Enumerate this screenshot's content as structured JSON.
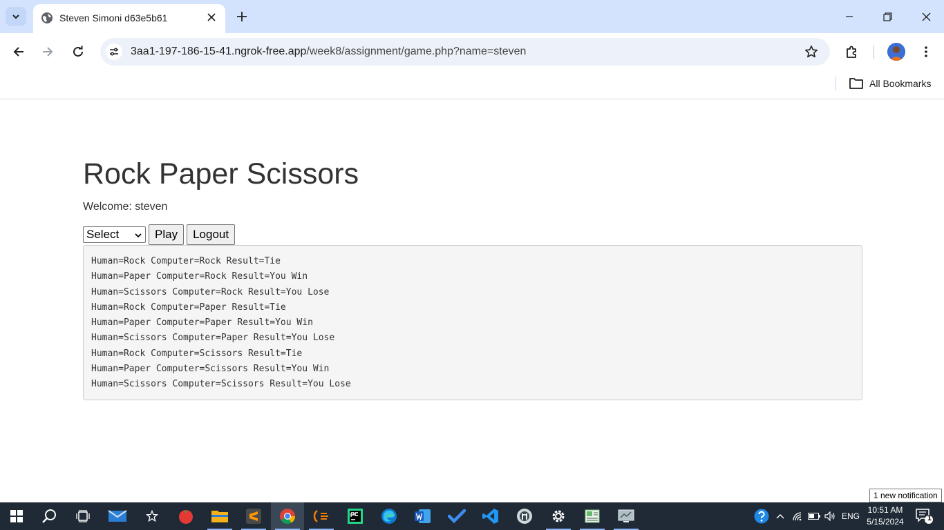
{
  "browser": {
    "tab": {
      "title": "Steven Simoni d63e5b61"
    },
    "address": {
      "host": "3aa1-197-186-15-41.ngrok-free.app",
      "path": "/week8/assignment/game.php?name=steven"
    },
    "bookmarks": {
      "all_label": "All Bookmarks"
    }
  },
  "page": {
    "title": "Rock Paper Scissors",
    "welcome": "Welcome: steven",
    "select": {
      "value": "Select"
    },
    "play_label": "Play",
    "logout_label": "Logout",
    "results": [
      "Human=Rock Computer=Rock Result=Tie",
      "Human=Paper Computer=Rock Result=You Win",
      "Human=Scissors Computer=Rock Result=You Lose",
      "Human=Rock Computer=Paper Result=Tie",
      "Human=Paper Computer=Paper Result=You Win",
      "Human=Scissors Computer=Paper Result=You Lose",
      "Human=Rock Computer=Scissors Result=Tie",
      "Human=Paper Computer=Scissors Result=You Win",
      "Human=Scissors Computer=Scissors Result=You Lose"
    ]
  },
  "notification": {
    "tooltip": "1 new notification",
    "count": "1"
  },
  "taskbar": {
    "apps": [
      "start-icon",
      "search-icon",
      "task-view-icon",
      "mail-icon",
      "pinned-star-icon",
      "tomato-icon",
      "file-explorer-icon",
      "sublime-text-icon",
      "chrome-icon",
      "eclipse-icon",
      "pycharm-icon",
      "edge-icon",
      "word-icon",
      "todo-icon",
      "vscode-icon",
      "app-icon",
      "settings-icon",
      "notepad-icon",
      "monitor-icon"
    ],
    "tray": {
      "language": "ENG",
      "time": "10:51 AM",
      "date": "5/15/2024"
    }
  },
  "colors": {
    "tabstrip": "#d3e3fd",
    "omnibox": "#edf2fa",
    "taskbar": "#1f2a36",
    "results_bg": "#f5f5f5"
  }
}
